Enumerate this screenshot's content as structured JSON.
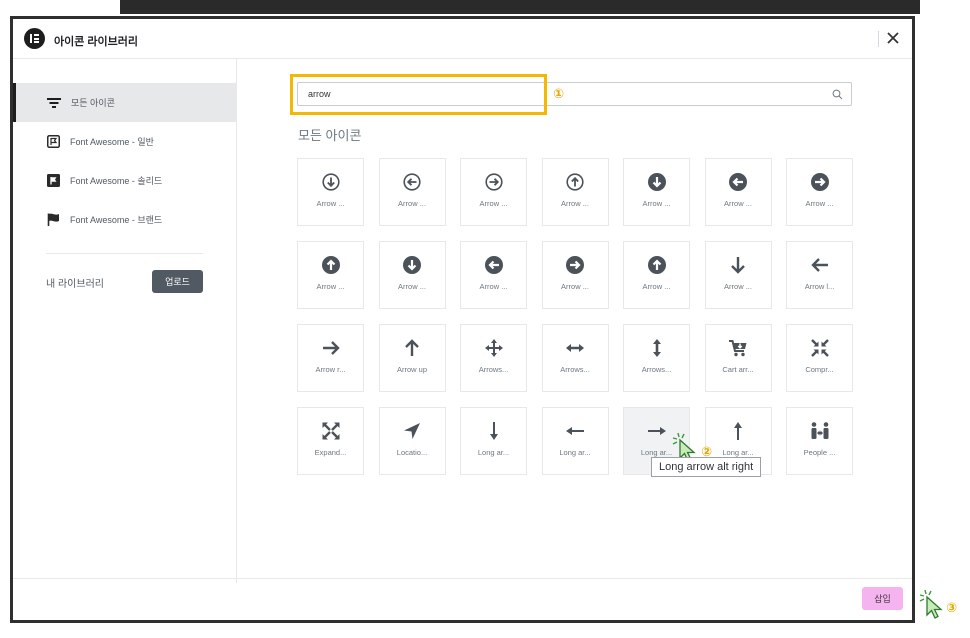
{
  "dialog": {
    "title": "아이콘 라이브러리",
    "close_icon": "close-icon"
  },
  "sidebar": {
    "items": [
      {
        "label": "모든 아이콘",
        "icon": "filter-icon",
        "active": true
      },
      {
        "label": "Font Awesome - 일반",
        "icon": "flag-regular-icon",
        "active": false
      },
      {
        "label": "Font Awesome - 솔리드",
        "icon": "flag-solid-square-icon",
        "active": false
      },
      {
        "label": "Font Awesome - 브랜드",
        "icon": "flag-brand-icon",
        "active": false
      }
    ],
    "my_library_label": "내 라이브러리",
    "upload_label": "업로드"
  },
  "search": {
    "value": "arrow",
    "placeholder": "",
    "icon": "search-icon"
  },
  "annotations": {
    "marker_1": "①",
    "marker_2": "②",
    "marker_3": "③",
    "highlight_color": "#f5b800"
  },
  "section_title": "모든 아이콘",
  "icons": [
    {
      "label": "Arrow ...",
      "icon": "arrow-circle-down-outline-icon"
    },
    {
      "label": "Arrow ...",
      "icon": "arrow-circle-left-outline-icon"
    },
    {
      "label": "Arrow ...",
      "icon": "arrow-circle-right-outline-icon"
    },
    {
      "label": "Arrow ...",
      "icon": "arrow-circle-up-outline-icon"
    },
    {
      "label": "Arrow ...",
      "icon": "arrow-circle-down-solid-icon"
    },
    {
      "label": "Arrow ...",
      "icon": "arrow-circle-left-solid-icon"
    },
    {
      "label": "Arrow ...",
      "icon": "arrow-circle-right-solid-icon"
    },
    {
      "label": "Arrow ...",
      "icon": "arrow-circle-up-solid-icon"
    },
    {
      "label": "Arrow ...",
      "icon": "arrow-circle-down-solid-icon"
    },
    {
      "label": "Arrow ...",
      "icon": "arrow-circle-left-solid-icon"
    },
    {
      "label": "Arrow ...",
      "icon": "arrow-circle-right-solid-icon"
    },
    {
      "label": "Arrow ...",
      "icon": "arrow-circle-up-solid-icon"
    },
    {
      "label": "Arrow ...",
      "icon": "arrow-down-icon"
    },
    {
      "label": "Arrow l...",
      "icon": "arrow-left-icon"
    },
    {
      "label": "Arrow r...",
      "icon": "arrow-right-icon"
    },
    {
      "label": "Arrow up",
      "icon": "arrow-up-icon"
    },
    {
      "label": "Arrows...",
      "icon": "arrows-move-icon"
    },
    {
      "label": "Arrows...",
      "icon": "arrows-horizontal-icon"
    },
    {
      "label": "Arrows...",
      "icon": "arrows-vertical-icon"
    },
    {
      "label": "Cart arr...",
      "icon": "cart-arrow-down-icon"
    },
    {
      "label": "Compr...",
      "icon": "compress-arrows-icon"
    },
    {
      "label": "Expand...",
      "icon": "expand-arrows-icon"
    },
    {
      "label": "Locatio...",
      "icon": "location-arrow-icon"
    },
    {
      "label": "Long ar...",
      "icon": "long-arrow-down-icon"
    },
    {
      "label": "Long ar...",
      "icon": "long-arrow-left-icon"
    },
    {
      "label": "Long ar...",
      "icon": "long-arrow-right-icon"
    },
    {
      "label": "Long ar...",
      "icon": "long-arrow-up-icon"
    },
    {
      "label": "People ...",
      "icon": "people-arrows-icon"
    }
  ],
  "tooltip": "Long arrow alt right",
  "footer": {
    "insert_label": "삽입",
    "insert_color": "#f5b3f0"
  }
}
